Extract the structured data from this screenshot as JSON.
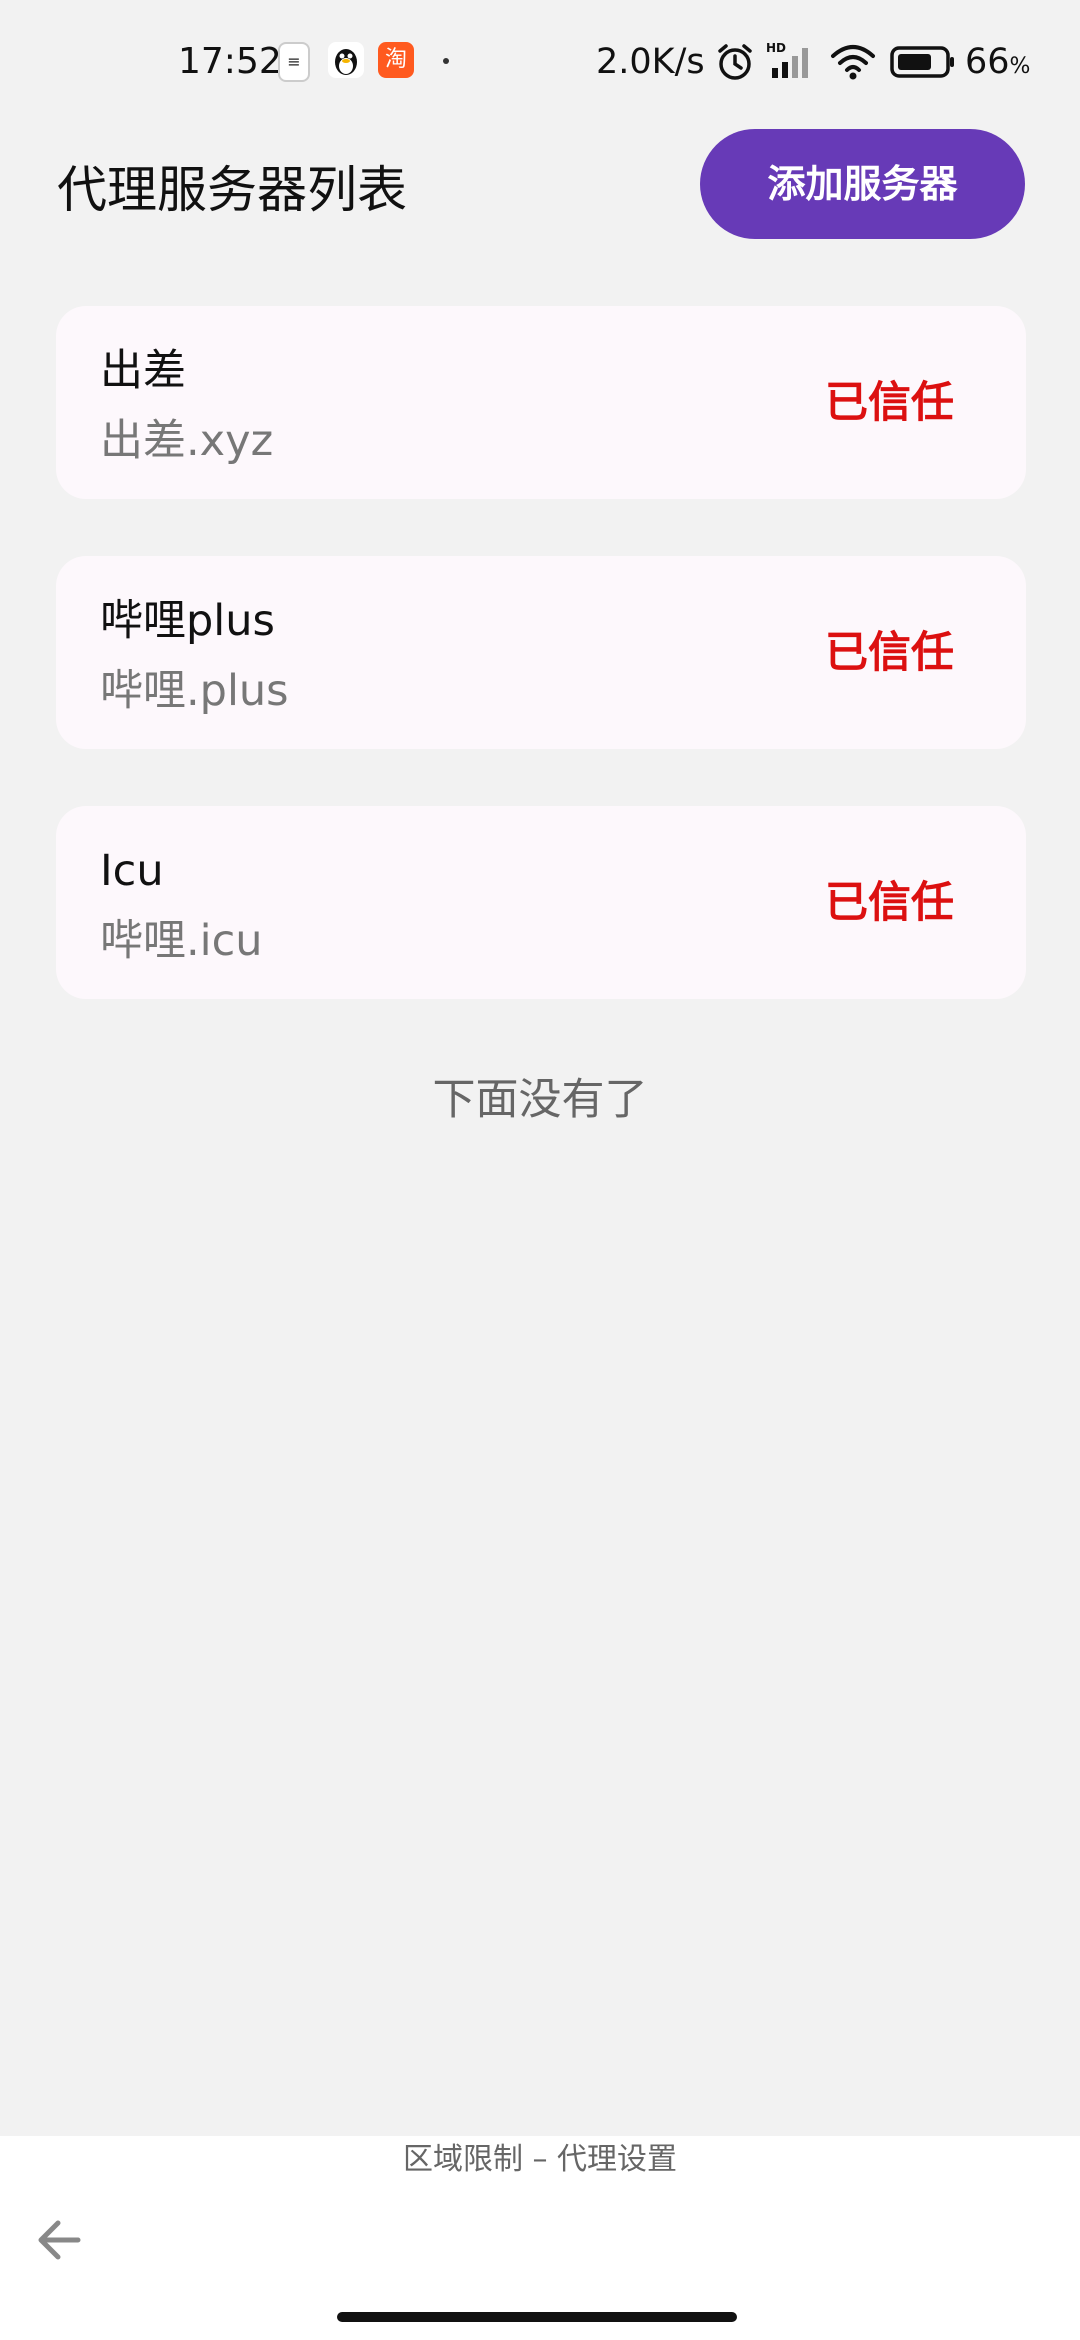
{
  "status_bar": {
    "time": "17:52",
    "net_speed": "2.0K/s",
    "battery_level": "66",
    "battery_unit": "%",
    "icons": [
      "notes-app-icon",
      "qq-icon",
      "taobao-icon",
      "alarm-icon",
      "hd-signal-icon",
      "wifi-icon",
      "battery-icon"
    ],
    "taobao_glyph": "淘"
  },
  "header": {
    "title": "代理服务器列表",
    "add_button_label": "添加服务器"
  },
  "servers": [
    {
      "name": "出差",
      "host": "出差.xyz",
      "status": "已信任"
    },
    {
      "name": "哔哩plus",
      "host": "哔哩.plus",
      "status": "已信任"
    },
    {
      "name": "Icu",
      "host": "哔哩.icu",
      "status": "已信任"
    }
  ],
  "list_end_text": "下面没有了",
  "bottom_caption": "区域限制 – 代理设置",
  "colors": {
    "accent": "#673ab7",
    "status_trusted": "#dc1010",
    "background": "#f2f2f2",
    "card": "#fdf8fc"
  }
}
